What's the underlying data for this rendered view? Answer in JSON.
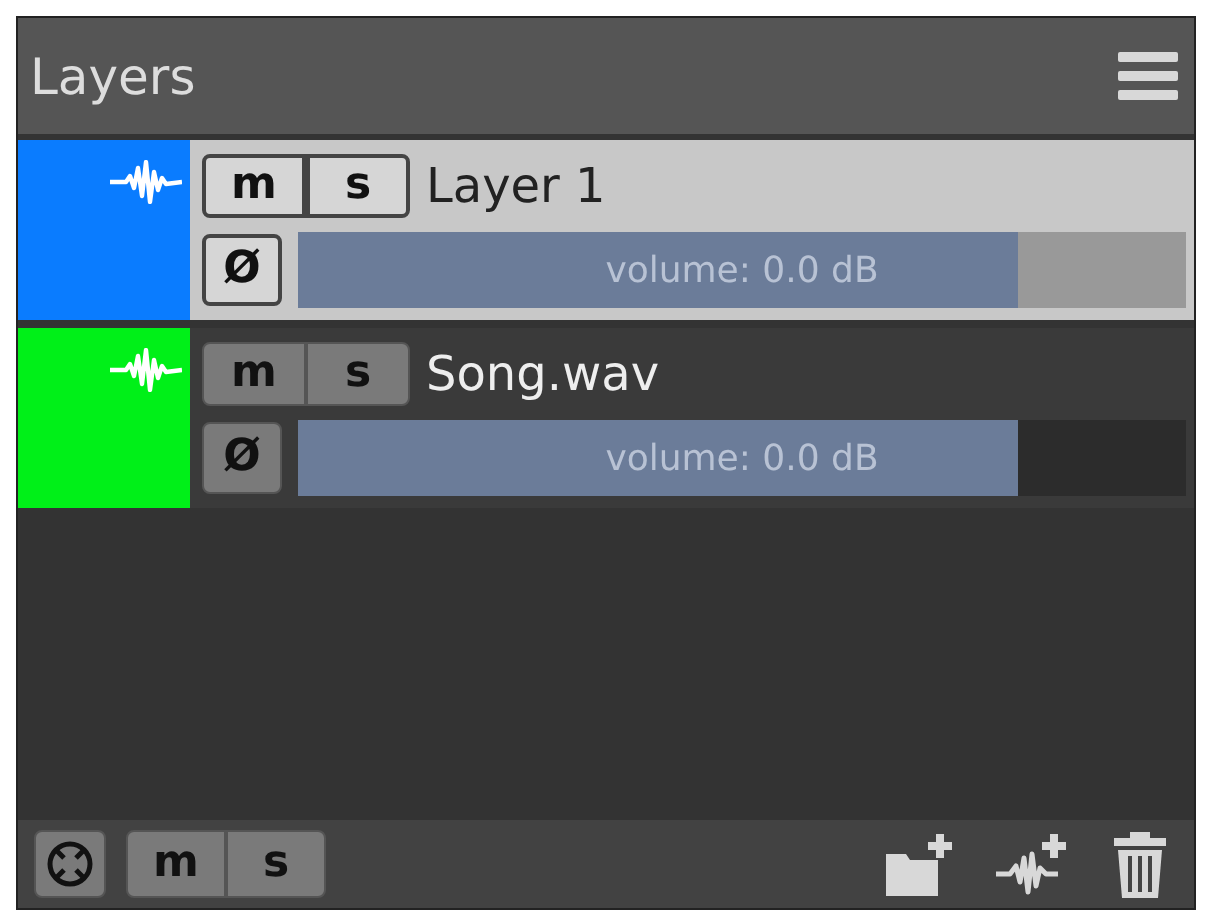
{
  "panel": {
    "title": "Layers"
  },
  "layers": [
    {
      "name": "Layer 1",
      "color": "#0a7cff",
      "selected": true,
      "mute_label": "m",
      "solo_label": "s",
      "phase_label": "Ø",
      "volume": "volume: 0.0 dB",
      "level": 0.81
    },
    {
      "name": "Song.wav",
      "color": "#00f018",
      "selected": false,
      "mute_label": "m",
      "solo_label": "s",
      "phase_label": "Ø",
      "volume": "volume: 0.0 dB",
      "level": 0.81
    }
  ],
  "footer": {
    "mute_label": "m",
    "solo_label": "s"
  }
}
